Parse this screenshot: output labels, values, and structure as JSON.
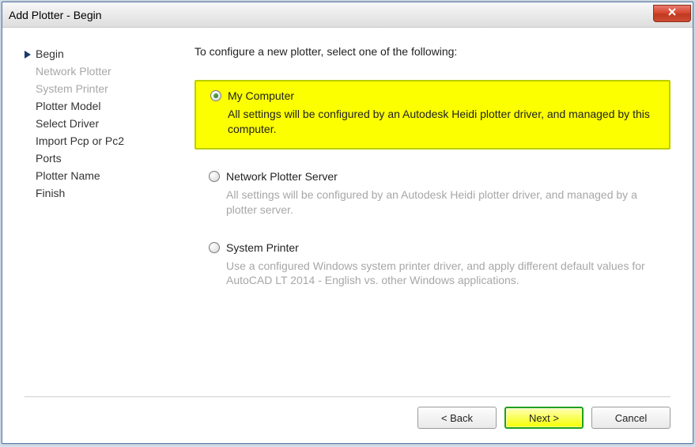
{
  "title": "Add Plotter - Begin",
  "sidebar": {
    "steps": [
      {
        "label": "Begin",
        "state": "current"
      },
      {
        "label": "Network Plotter",
        "state": "disabled"
      },
      {
        "label": "System Printer",
        "state": "disabled"
      },
      {
        "label": "Plotter Model",
        "state": "normal"
      },
      {
        "label": "Select Driver",
        "state": "normal"
      },
      {
        "label": "Import Pcp or Pc2",
        "state": "normal"
      },
      {
        "label": "Ports",
        "state": "normal"
      },
      {
        "label": "Plotter Name",
        "state": "normal"
      },
      {
        "label": "Finish",
        "state": "normal"
      }
    ]
  },
  "instruction": "To configure a new plotter, select one of the following:",
  "options": [
    {
      "label": "My Computer",
      "desc": "All settings will be configured by an Autodesk Heidi plotter driver, and managed by this computer.",
      "selected": true,
      "highlighted": true
    },
    {
      "label": "Network Plotter Server",
      "desc": "All settings will be configured by an Autodesk Heidi plotter driver, and managed by a plotter server.",
      "selected": false,
      "highlighted": false
    },
    {
      "label": "System Printer",
      "desc": "Use a configured Windows system printer driver, and apply different default values for AutoCAD LT 2014 - English vs. other Windows applications.",
      "selected": false,
      "highlighted": false
    }
  ],
  "buttons": {
    "back": "< Back",
    "next": "Next >",
    "cancel": "Cancel"
  }
}
